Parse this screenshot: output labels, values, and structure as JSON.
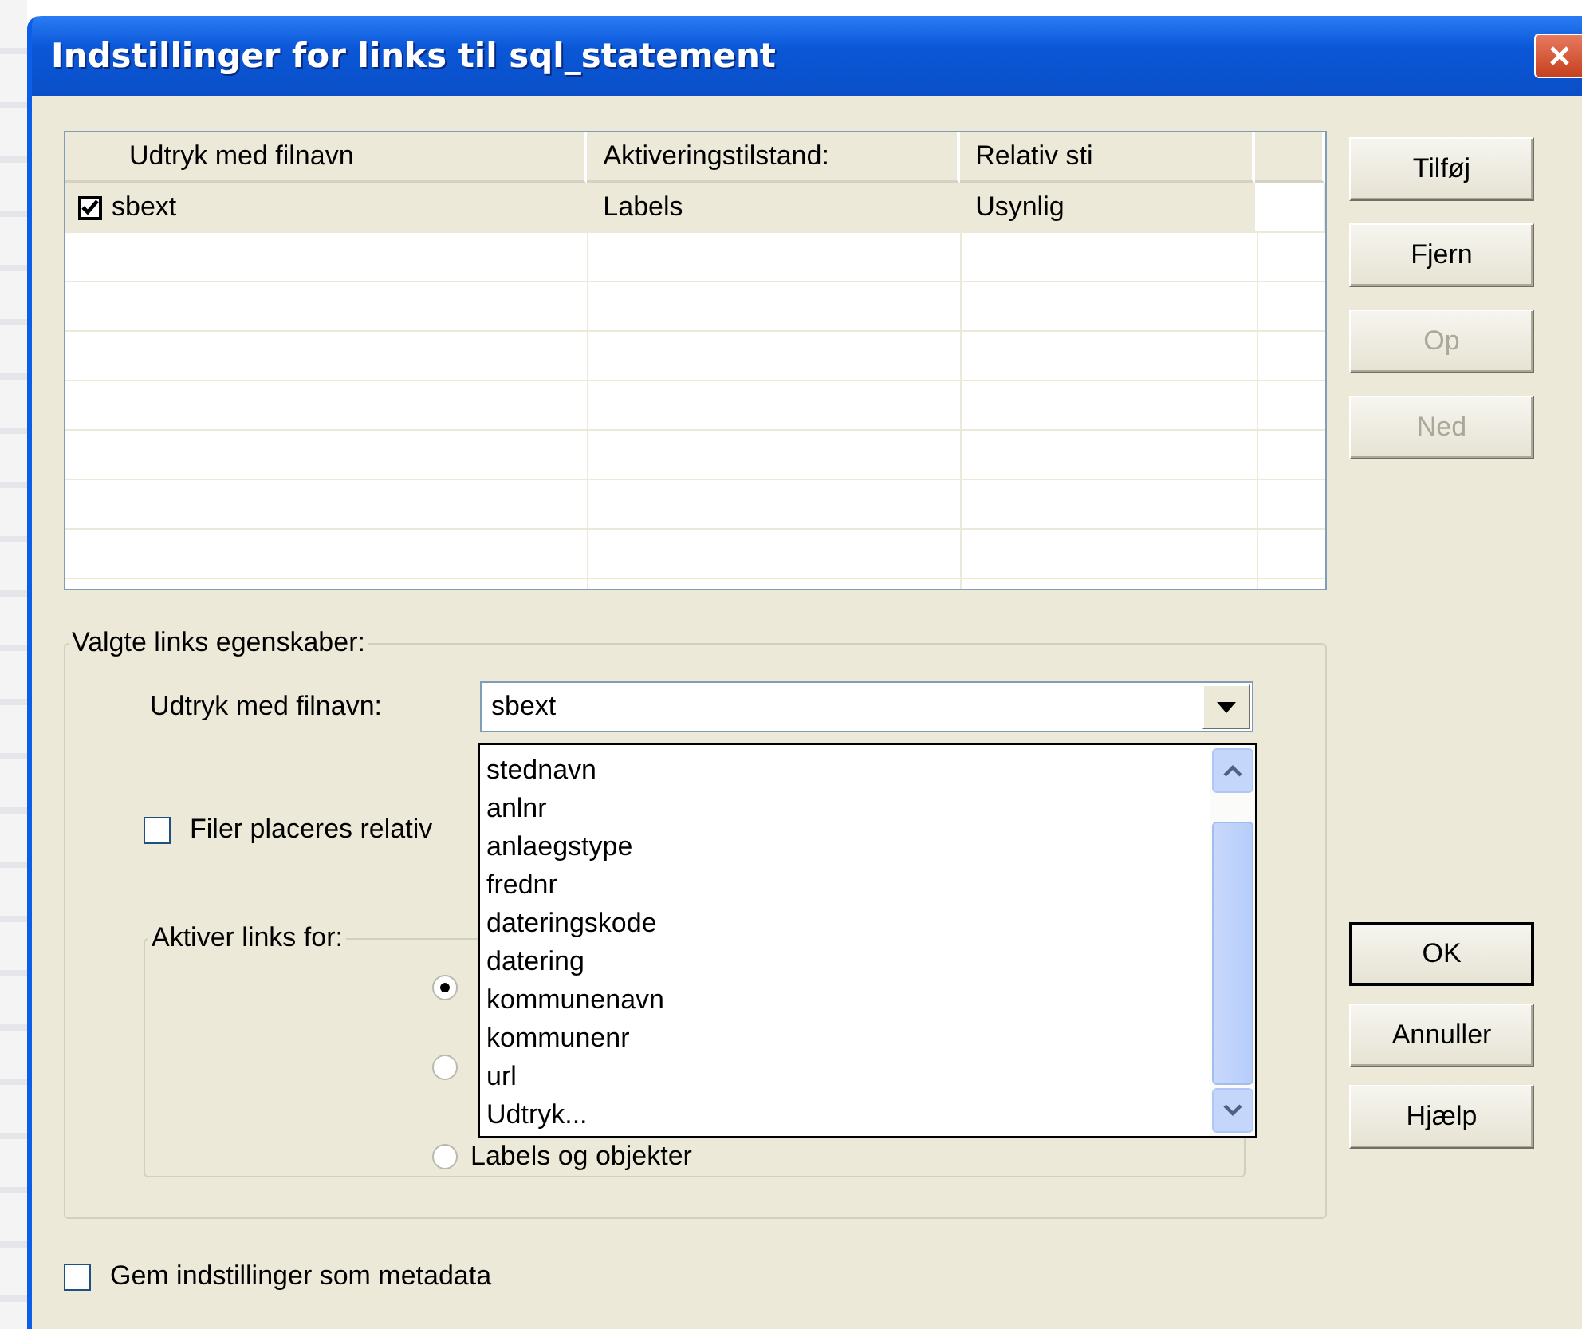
{
  "window": {
    "title": "Indstillinger for links til sql_statement"
  },
  "links_table": {
    "columns": [
      "Udtryk med filnavn",
      "Aktiveringstilstand:",
      "Relativ sti"
    ],
    "rows": [
      {
        "checked": true,
        "selected": true,
        "cells": [
          "sbext",
          "Labels",
          "Usynlig"
        ]
      }
    ]
  },
  "side_buttons": [
    {
      "label": "Tilføj",
      "disabled": false
    },
    {
      "label": "Fjern",
      "disabled": false
    },
    {
      "label": "Op",
      "disabled": true
    },
    {
      "label": "Ned",
      "disabled": true
    }
  ],
  "properties_group": {
    "title": "Valgte links egenskaber:",
    "expression_label": "Udtryk med filnavn:",
    "expression_value": "sbext",
    "dropdown": {
      "options": [
        "stednavn",
        "anlnr",
        "anlaegstype",
        "frednr",
        "dateringskode",
        "datering",
        "kommunenavn",
        "kommunenr",
        "url",
        "Udtryk..."
      ]
    },
    "relative_checkbox": {
      "label": "Filer placeres relativ",
      "checked": false
    },
    "activate_group": {
      "title": "Aktiver links for:",
      "options": [
        {
          "selected": true
        },
        {
          "selected": false
        },
        {
          "label": "Labels og objekter",
          "selected": false
        }
      ]
    }
  },
  "dialog_buttons": [
    {
      "label": "OK",
      "default": true
    },
    {
      "label": "Annuller",
      "default": false
    },
    {
      "label": "Hjælp",
      "default": false
    }
  ],
  "metadata_checkbox": {
    "label": "Gem indstillinger som metadata",
    "checked": false
  }
}
